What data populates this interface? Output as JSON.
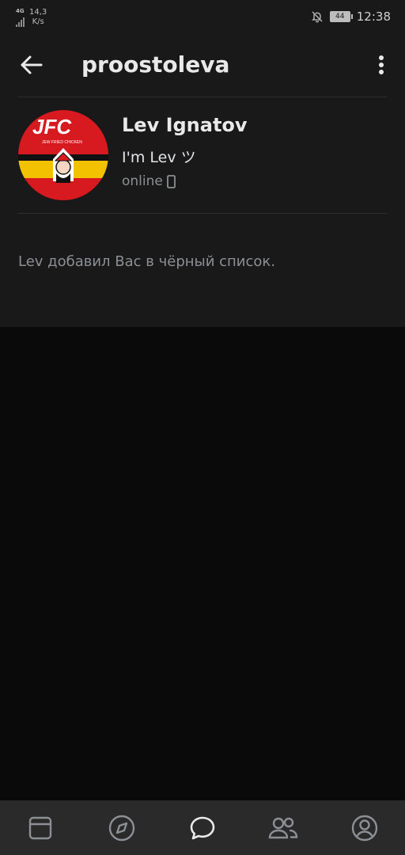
{
  "status_bar": {
    "network_type": "4G",
    "data_speed_value": "14,3",
    "data_speed_unit": "K/s",
    "battery_level": "44",
    "time": "12:38",
    "icons": [
      "signal-icon",
      "bell-off-icon",
      "battery-icon"
    ]
  },
  "header": {
    "title": "proostoleva",
    "back_icon": "arrow-left-icon",
    "menu_icon": "more-vertical-icon"
  },
  "profile": {
    "name": "Lev Ignatov",
    "status": "I'm Lev ツ",
    "online_text": "online",
    "device_icon": "mobile-icon",
    "avatar_logo_text": "JFC",
    "avatar_subtitle": "JEW FRIED CHICKEN"
  },
  "notice": "Lev добавил Вас в чёрный список.",
  "colors": {
    "panel_bg": "#191919",
    "page_bg": "#0a0a0a",
    "tabbar_bg": "#2a2a2a",
    "avatar_red": "#d71920",
    "avatar_yellow": "#f2c200"
  },
  "tabbar": {
    "tabs": [
      {
        "icon": "news-feed-icon",
        "active": false
      },
      {
        "icon": "compass-icon",
        "active": false
      },
      {
        "icon": "messages-icon",
        "active": true
      },
      {
        "icon": "friends-icon",
        "active": false
      },
      {
        "icon": "profile-icon",
        "active": false
      }
    ]
  }
}
